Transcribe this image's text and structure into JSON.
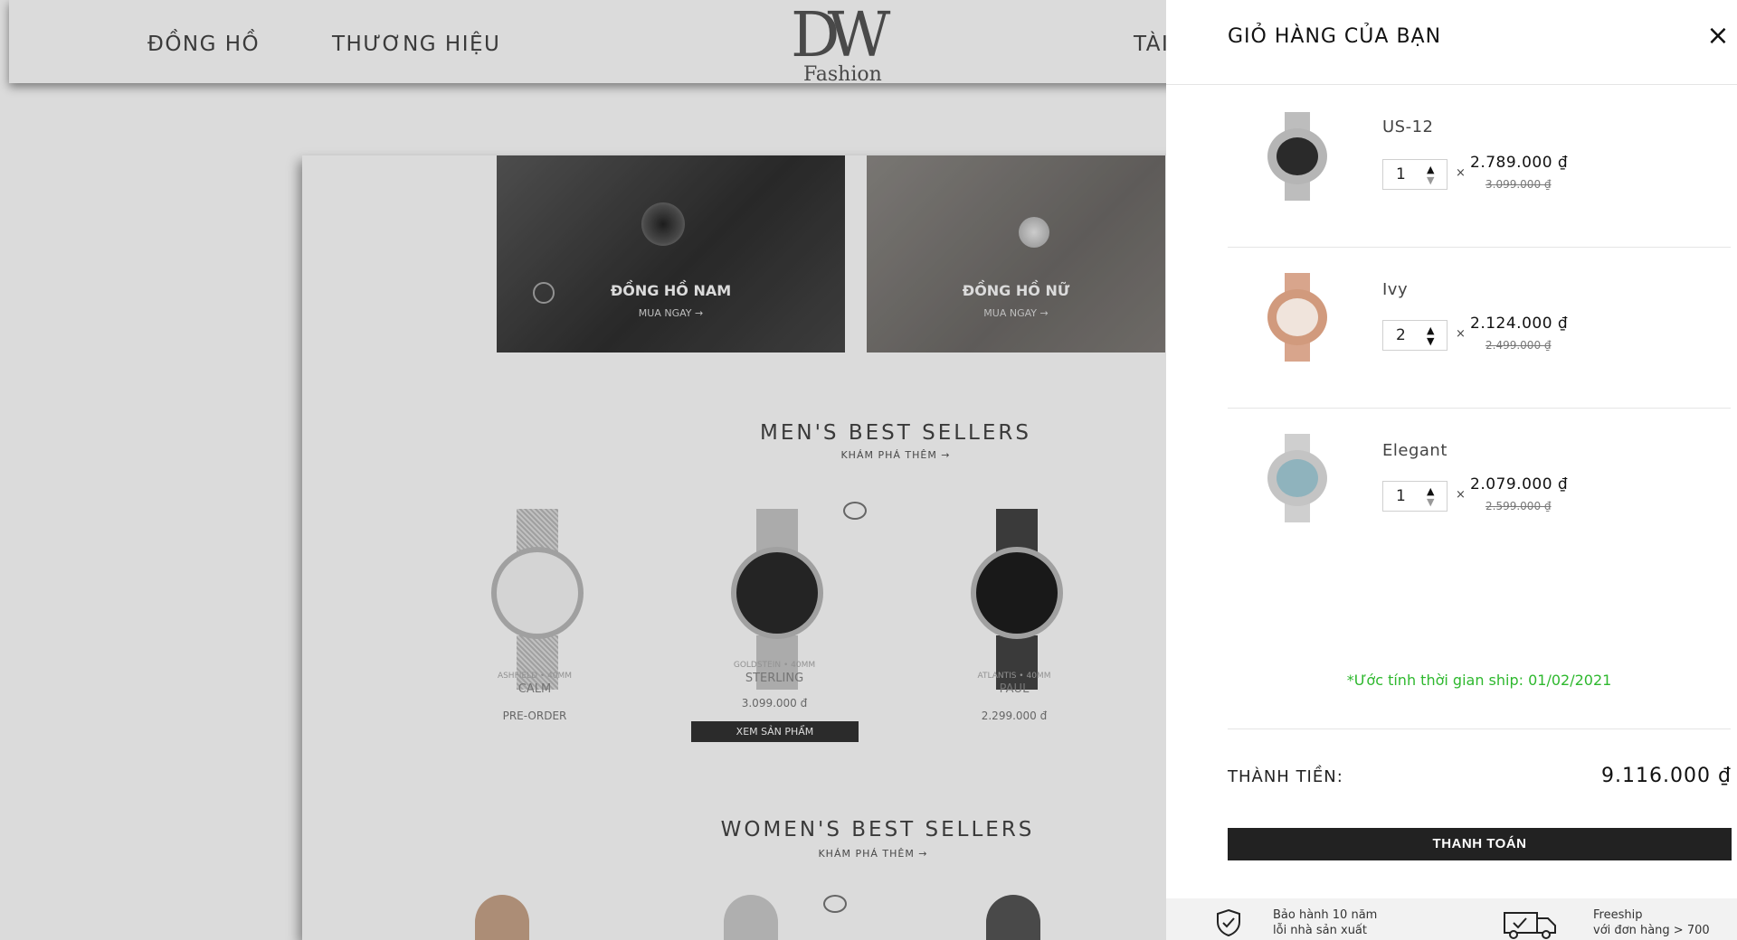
{
  "site": {
    "nav": [
      "ĐỒNG HỒ",
      "THƯƠNG HIỆU",
      "TÀI"
    ],
    "logo_mark": "DW",
    "logo_sub": "Fashion"
  },
  "promos": [
    {
      "title": "ĐỒNG HỒ NAM",
      "cta": "MUA NGAY →"
    },
    {
      "title": "ĐỒNG HỒ NỮ",
      "cta": "MUA NGAY →"
    }
  ],
  "sections": {
    "men": {
      "title": "MEN'S BEST SELLERS",
      "sub": "KHÁM PHÁ THÊM →"
    },
    "women": {
      "title": "WOMEN'S BEST SELLERS",
      "sub": "KHÁM PHÁ THÊM →"
    }
  },
  "products": [
    {
      "small": "ASHFIELD • 40MM",
      "name": "CALM",
      "price": "PRE-ORDER"
    },
    {
      "small": "GOLDSTEIN • 40MM",
      "name": "STERLING",
      "price": "3.099.000 đ",
      "button": "XEM SẢN PHẨM"
    },
    {
      "small": "ATLANTIS • 40MM",
      "name": "PAUL",
      "price": "2.299.000 đ"
    }
  ],
  "cart": {
    "title": "GIỎ HÀNG CỦA BẠN",
    "close_icon": "×",
    "times": "×",
    "items": [
      {
        "name": "US-12",
        "qty": "1",
        "price": "2.789.000 ₫",
        "old_price": "3.099.000 ₫",
        "dial_color": "#2a2a2a",
        "case_color": "#b5b5b5"
      },
      {
        "name": "Ivy",
        "qty": "2",
        "price": "2.124.000 ₫",
        "old_price": "2.499.000 ₫",
        "dial_color": "#f0e4dc",
        "case_color": "#d19a7d"
      },
      {
        "name": "Elegant",
        "qty": "1",
        "price": "2.079.000 ₫",
        "old_price": "2.599.000 ₫",
        "dial_color": "#8fb3bd",
        "case_color": "#c4c4c4"
      }
    ],
    "ship_estimate": "*Ước tính thời gian ship: 01/02/2021",
    "total_label": "THÀNH TIỀN:",
    "total_value": "9.116.000 ₫",
    "checkout_label": "THANH TOÁN",
    "perks": [
      {
        "line1": "Bảo hành 10 năm",
        "line2": "lỗi nhà sản xuất",
        "icon": "shield-check-icon"
      },
      {
        "line1": "Freeship",
        "line2": "với đơn hàng > 700",
        "icon": "delivery-truck-icon"
      }
    ]
  },
  "colors": {
    "accent_green": "#2eb82e",
    "button_dark": "#222222"
  }
}
